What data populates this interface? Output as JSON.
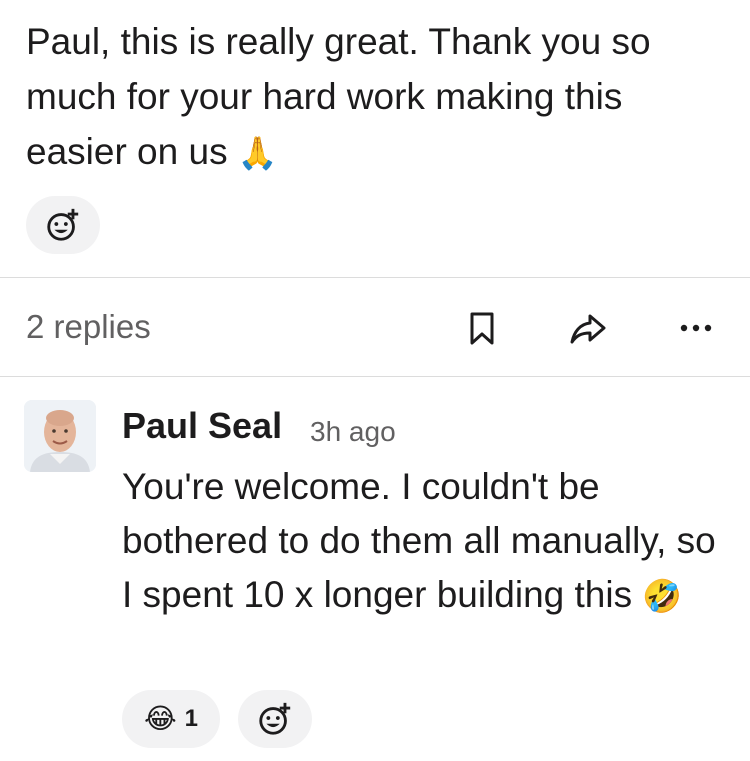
{
  "message": {
    "text": "Paul, this is really great. Thank you so much for your hard work making this easier on us",
    "emoji": "🙏"
  },
  "thread": {
    "replies_label": "2 replies",
    "actions": [
      "bookmark-icon",
      "share-icon",
      "more-icon"
    ]
  },
  "reply": {
    "author": "Paul Seal",
    "timestamp": "3h ago",
    "text": "You're welcome. I couldn't be bothered to do them all manually, so I spent 10 x longer building this",
    "emoji": "🤣",
    "reactions": [
      {
        "emoji": "😂",
        "count": "1"
      }
    ]
  },
  "colors": {
    "text": "#1d1c1d",
    "muted": "#616061",
    "pill": "#f2f2f3",
    "divider": "#dcdcdc"
  }
}
